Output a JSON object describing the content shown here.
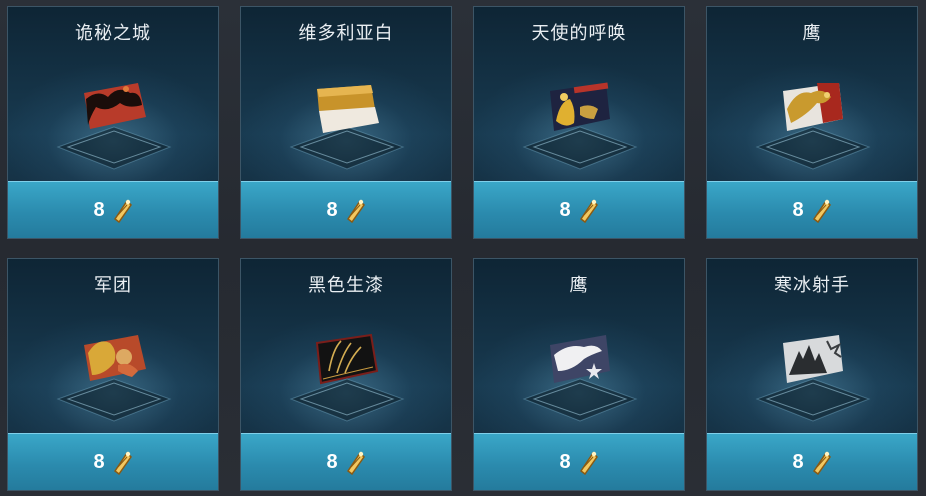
{
  "cards": [
    {
      "title": "诡秘之城",
      "price": "8",
      "item_icon": "camo-red-black-icon"
    },
    {
      "title": "维多利亚白",
      "price": "8",
      "item_icon": "camo-gold-white-icon"
    },
    {
      "title": "天使的呼唤",
      "price": "8",
      "item_icon": "camo-angel-gold-icon"
    },
    {
      "title": "鹰",
      "price": "8",
      "item_icon": "camo-eagle-gold-icon"
    },
    {
      "title": "军团",
      "price": "8",
      "item_icon": "camo-legion-icon"
    },
    {
      "title": "黑色生漆",
      "price": "8",
      "item_icon": "camo-black-lacquer-icon"
    },
    {
      "title": "鹰",
      "price": "8",
      "item_icon": "camo-eagle-star-icon"
    },
    {
      "title": "寒冰射手",
      "price": "8",
      "item_icon": "camo-frost-archer-icon"
    }
  ],
  "currency_icon": "gold-bond-icon",
  "colors": {
    "price_bar": "#2b8bae",
    "card_bg": "#183a50",
    "page_bg": "#2a2e35"
  }
}
